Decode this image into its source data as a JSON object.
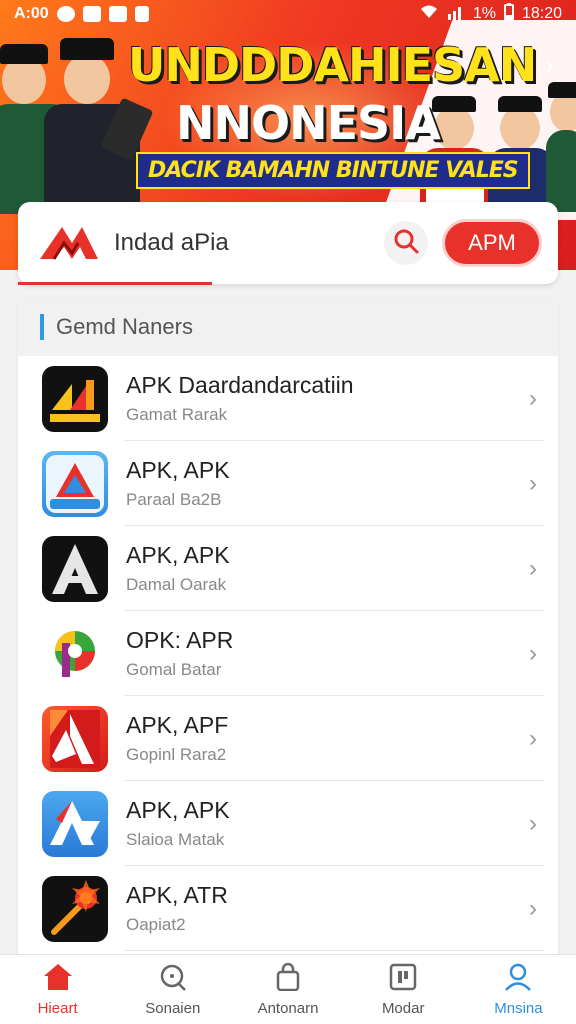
{
  "status_bar": {
    "time_left": "A:00",
    "battery": "1%",
    "time_right": "18:20"
  },
  "banner": {
    "title_line1": "UNDDDAHIESAN",
    "title_line2": "NNONESIA",
    "subtitle": "DACIK BAMAHN BINTUNE VALES"
  },
  "search_card": {
    "text": "Indad aPia",
    "button_label": "APM"
  },
  "panel": {
    "title": "Gemd Naners",
    "items": [
      {
        "title": "APK Daardandarcatiin",
        "subtitle": "Gamat Rarak",
        "icon": "black-orange-bars-icon"
      },
      {
        "title": "APK, APK",
        "subtitle": "Paraal Ba2B",
        "icon": "triangle-store-icon"
      },
      {
        "title": "APK, APK",
        "subtitle": "Damal Oarak",
        "icon": "black-a-icon"
      },
      {
        "title": "OPK: APR",
        "subtitle": "Gomal Batar",
        "icon": "colorful-p-icon"
      },
      {
        "title": "APK, APF",
        "subtitle": "Gopinl Rara2",
        "icon": "red-a-icon"
      },
      {
        "title": "APK, APK",
        "subtitle": "Slaioa Matak",
        "icon": "blue-a-icon"
      },
      {
        "title": "APK, ATR",
        "subtitle": "Oapiat2",
        "icon": "fire-wand-icon"
      }
    ]
  },
  "bottom_nav": [
    {
      "label": "Hieart",
      "icon": "home-icon"
    },
    {
      "label": "Sonaien",
      "icon": "search-icon"
    },
    {
      "label": "Antonarn",
      "icon": "bag-icon"
    },
    {
      "label": "Modar",
      "icon": "frame-icon"
    },
    {
      "label": "Mnsina",
      "icon": "profile-icon"
    }
  ],
  "colors": {
    "accent": "#e8312a",
    "blue": "#2f8ee0"
  }
}
